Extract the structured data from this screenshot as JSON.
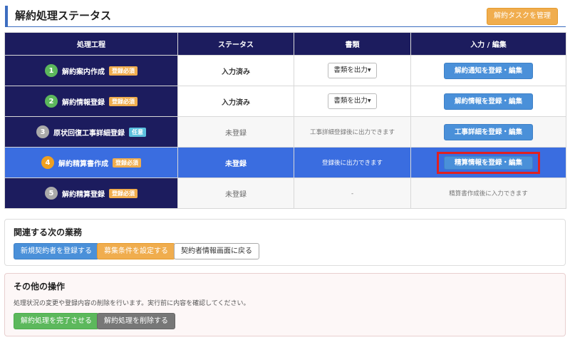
{
  "header": {
    "title": "解約処理ステータス",
    "manage_button": "解約タスクを管理"
  },
  "table": {
    "columns": [
      "処理工程",
      "ステータス",
      "書類",
      "入力 / 編集"
    ],
    "rows": [
      {
        "num": "1",
        "step": "解約案内作成",
        "badge": "登録必須",
        "status": "入力済み",
        "doc": "書類を出力▾",
        "doc_note": "",
        "action": "解約通知を登録・編集",
        "action_note": ""
      },
      {
        "num": "2",
        "step": "解約情報登録",
        "badge": "登録必須",
        "status": "入力済み",
        "doc": "書類を出力▾",
        "doc_note": "",
        "action": "解約情報を登録・編集",
        "action_note": ""
      },
      {
        "num": "3",
        "step": "原状回復工事詳細登録",
        "badge": "任意",
        "status": "未登録",
        "doc": "",
        "doc_note": "工事詳細登録後に出力できます",
        "action": "工事詳細を登録・編集",
        "action_note": ""
      },
      {
        "num": "4",
        "step": "解約精算書作成",
        "badge": "登録必須",
        "status": "未登録",
        "doc": "",
        "doc_note": "登録後に出力できます",
        "action": "精算情報を登録・編集",
        "action_note": ""
      },
      {
        "num": "5",
        "step": "解約精算登録",
        "badge": "登録必須",
        "status": "未登録",
        "doc": "",
        "doc_note": "-",
        "action": "",
        "action_note": "精算書作成後に入力できます"
      }
    ]
  },
  "related": {
    "title": "関連する次の業務",
    "buttons": [
      "新規契約者を登録する",
      "募集条件を設定する",
      "契約者情報画面に戻る"
    ]
  },
  "other": {
    "title": "その他の操作",
    "description": "処理状況の変更や登録内容の削除を行います。実行前に内容を確認してください。",
    "complete_button": "解約処理を完了させる",
    "delete_button": "解約処理を削除する"
  },
  "colors": {
    "navy": "#1c1c5e",
    "active_row": "#3a6de0",
    "highlight": "#e02020",
    "green": "#5cb85c",
    "orange": "#f0ad4e",
    "blue": "#4a90d9",
    "grey_circle": "#aaaaaa"
  }
}
